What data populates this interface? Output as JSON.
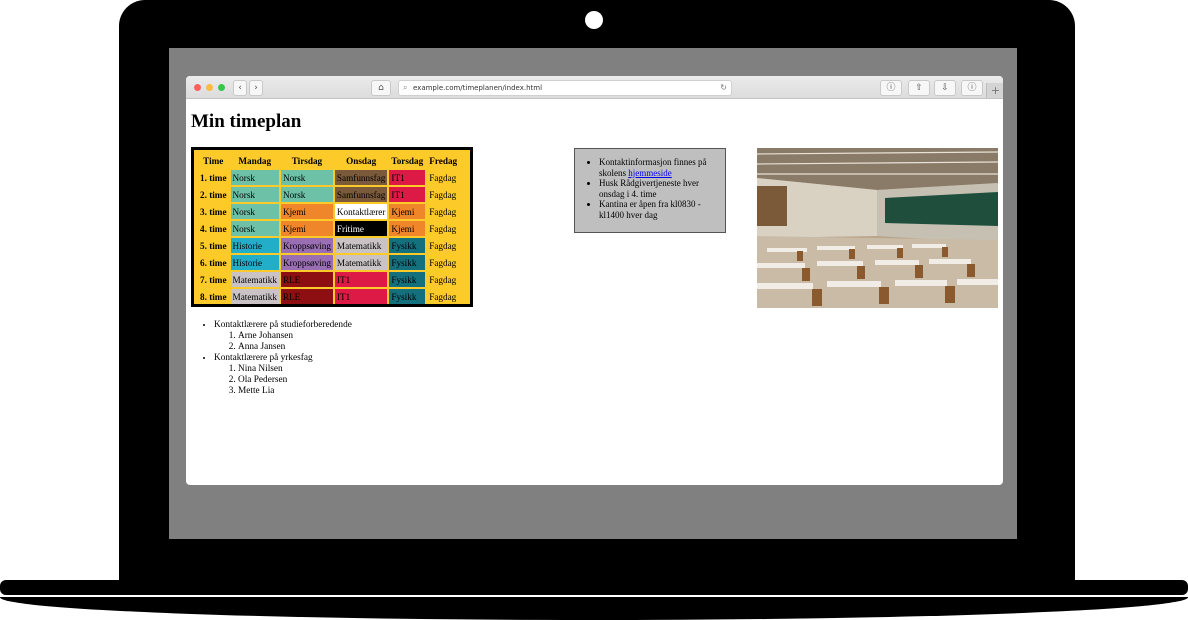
{
  "browser": {
    "url": "example.com/timeplanen/index.html",
    "back_icon": "chevron-left-icon",
    "forward_icon": "chevron-right-icon",
    "home_icon": "home-icon"
  },
  "page": {
    "title": "Min timeplan",
    "timetable": {
      "headers": [
        "Time",
        "Mandag",
        "Tirsdag",
        "Onsdag",
        "Torsdag",
        "Fredag"
      ],
      "rows": [
        {
          "time": "1. time",
          "cells": [
            {
              "text": "Norsk",
              "bg": "#6cc1a7",
              "fg": "#000"
            },
            {
              "text": "Norsk",
              "bg": "#6cc1a7",
              "fg": "#000"
            },
            {
              "text": "Samfunnsfag",
              "bg": "#7a5a3b",
              "fg": "#000"
            },
            {
              "text": "IT1",
              "bg": "#dc1a45",
              "fg": "#000"
            },
            {
              "text": "Fagdag",
              "bg": "#fcca29",
              "fg": "#000"
            }
          ]
        },
        {
          "time": "2. time",
          "cells": [
            {
              "text": "Norsk",
              "bg": "#6cc1a7",
              "fg": "#000"
            },
            {
              "text": "Norsk",
              "bg": "#6cc1a7",
              "fg": "#000"
            },
            {
              "text": "Samfunnsfag",
              "bg": "#7a5a3b",
              "fg": "#000"
            },
            {
              "text": "IT1",
              "bg": "#dc1a45",
              "fg": "#000"
            },
            {
              "text": "Fagdag",
              "bg": "#fcca29",
              "fg": "#000"
            }
          ]
        },
        {
          "time": "3. time",
          "cells": [
            {
              "text": "Norsk",
              "bg": "#6cc1a7",
              "fg": "#000"
            },
            {
              "text": "Kjemi",
              "bg": "#f0862a",
              "fg": "#000"
            },
            {
              "text": "Kontaktlærer",
              "bg": "#ffffff",
              "fg": "#000"
            },
            {
              "text": "Kjemi",
              "bg": "#f0862a",
              "fg": "#000"
            },
            {
              "text": "Fagdag",
              "bg": "#fcca29",
              "fg": "#000"
            }
          ]
        },
        {
          "time": "4. time",
          "cells": [
            {
              "text": "Norsk",
              "bg": "#6cc1a7",
              "fg": "#000"
            },
            {
              "text": "Kjemi",
              "bg": "#f0862a",
              "fg": "#000"
            },
            {
              "text": "Fritime",
              "bg": "#000000",
              "fg": "#fff"
            },
            {
              "text": "Kjemi",
              "bg": "#f0862a",
              "fg": "#000"
            },
            {
              "text": "Fagdag",
              "bg": "#fcca29",
              "fg": "#000"
            }
          ]
        },
        {
          "time": "5. time",
          "cells": [
            {
              "text": "Historie",
              "bg": "#22aec8",
              "fg": "#000"
            },
            {
              "text": "Kroppsøving",
              "bg": "#9a6eb3",
              "fg": "#000"
            },
            {
              "text": "Matematikk",
              "bg": "#c9c3c5",
              "fg": "#000"
            },
            {
              "text": "Fysikk",
              "bg": "#15707e",
              "fg": "#000"
            },
            {
              "text": "Fagdag",
              "bg": "#fcca29",
              "fg": "#000"
            }
          ]
        },
        {
          "time": "6. time",
          "cells": [
            {
              "text": "Historie",
              "bg": "#22aec8",
              "fg": "#000"
            },
            {
              "text": "Kroppsøving",
              "bg": "#9a6eb3",
              "fg": "#000"
            },
            {
              "text": "Matematikk",
              "bg": "#c9c3c5",
              "fg": "#000"
            },
            {
              "text": "Fysikk",
              "bg": "#15707e",
              "fg": "#000"
            },
            {
              "text": "Fagdag",
              "bg": "#fcca29",
              "fg": "#000"
            }
          ]
        },
        {
          "time": "7. time",
          "cells": [
            {
              "text": "Matematikk",
              "bg": "#c9c3c5",
              "fg": "#000"
            },
            {
              "text": "RLE",
              "bg": "#8e0f12",
              "fg": "#000"
            },
            {
              "text": "IT1",
              "bg": "#dc1a45",
              "fg": "#000"
            },
            {
              "text": "Fysikk",
              "bg": "#15707e",
              "fg": "#000"
            },
            {
              "text": "Fagdag",
              "bg": "#fcca29",
              "fg": "#000"
            }
          ]
        },
        {
          "time": "8. time",
          "cells": [
            {
              "text": "Matematikk",
              "bg": "#c9c3c5",
              "fg": "#000"
            },
            {
              "text": "RLE",
              "bg": "#8e0f12",
              "fg": "#000"
            },
            {
              "text": "IT1",
              "bg": "#dc1a45",
              "fg": "#000"
            },
            {
              "text": "Fysikk",
              "bg": "#15707e",
              "fg": "#000"
            },
            {
              "text": "Fagdag",
              "bg": "#fcca29",
              "fg": "#000"
            }
          ]
        }
      ]
    },
    "contacts": [
      {
        "label": "Kontaktlærere på studieforberedende",
        "names": [
          "Arne Johansen",
          "Anna Jansen"
        ]
      },
      {
        "label": "Kontaktlærere på yrkesfag",
        "names": [
          "Nina Nilsen",
          "Ola Pedersen",
          "Mette Lia"
        ]
      }
    ],
    "info": {
      "item1_text": "Kontaktinformasjon finnes på skolens ",
      "item1_link": "hjemmeside",
      "item2": "Husk Rådgivertjeneste hver onsdag i 4. time",
      "item3": "Kantina er åpen fra kl0830 - kl1400 hver dag"
    }
  },
  "colors": {
    "timetable_bg": "#fcca29",
    "info_bg": "#bfbfbf",
    "link": "#0000ee"
  }
}
